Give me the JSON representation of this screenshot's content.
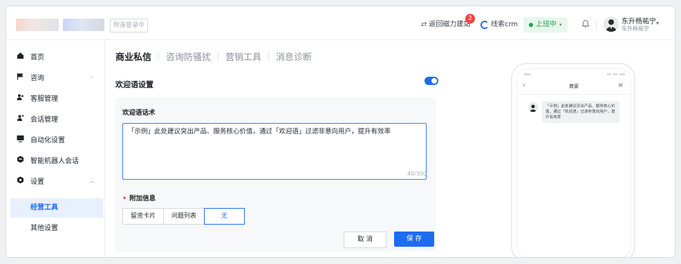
{
  "header": {
    "login_chip": "附身登录中",
    "back_link": "返回磁力建站",
    "back_badge": "2",
    "crm_link": "线索crm",
    "status": "上班中",
    "user_name": "东升杨祐宁",
    "user_sub": "东升杨祐宁"
  },
  "sidebar": {
    "items": [
      {
        "label": "首页",
        "icon": "home-icon"
      },
      {
        "label": "咨询",
        "icon": "flag-icon"
      },
      {
        "label": "客服管理",
        "icon": "users-icon"
      },
      {
        "label": "会话管理",
        "icon": "chat-user-icon"
      },
      {
        "label": "自动化设置",
        "icon": "screen-icon"
      },
      {
        "label": "智能机器人会话",
        "icon": "robot-icon"
      },
      {
        "label": "设置",
        "icon": "settings-icon"
      }
    ],
    "subitems": [
      {
        "label": "经营工具"
      },
      {
        "label": "其他设置"
      }
    ]
  },
  "tabs": [
    "商业私信",
    "咨询防骚扰",
    "营销工具",
    "消息诊断"
  ],
  "section": {
    "title": "欢迎语设置",
    "toggle_on": true
  },
  "welcome": {
    "label": "欢迎语话术",
    "text": "「示例」此处建议突出产品、服务核心价值，通过「欢迎语」过滤非意向用户，提升有效率",
    "counter": "40/300"
  },
  "extra": {
    "label": "附加信息",
    "options": [
      "留资卡片",
      "问题列表",
      "无"
    ],
    "selected": "无"
  },
  "actions": {
    "cancel": "取 消",
    "save": "保 存"
  },
  "preview": {
    "title": "商家",
    "bubble": "「示例」此处建议突出产品、服务核心价值，通过「欢迎语」过滤非意向用户，提升有效率"
  },
  "colors": {
    "accent": "#1d6cf0",
    "status_green": "#1aa34a",
    "badge_red": "#f2453d"
  }
}
